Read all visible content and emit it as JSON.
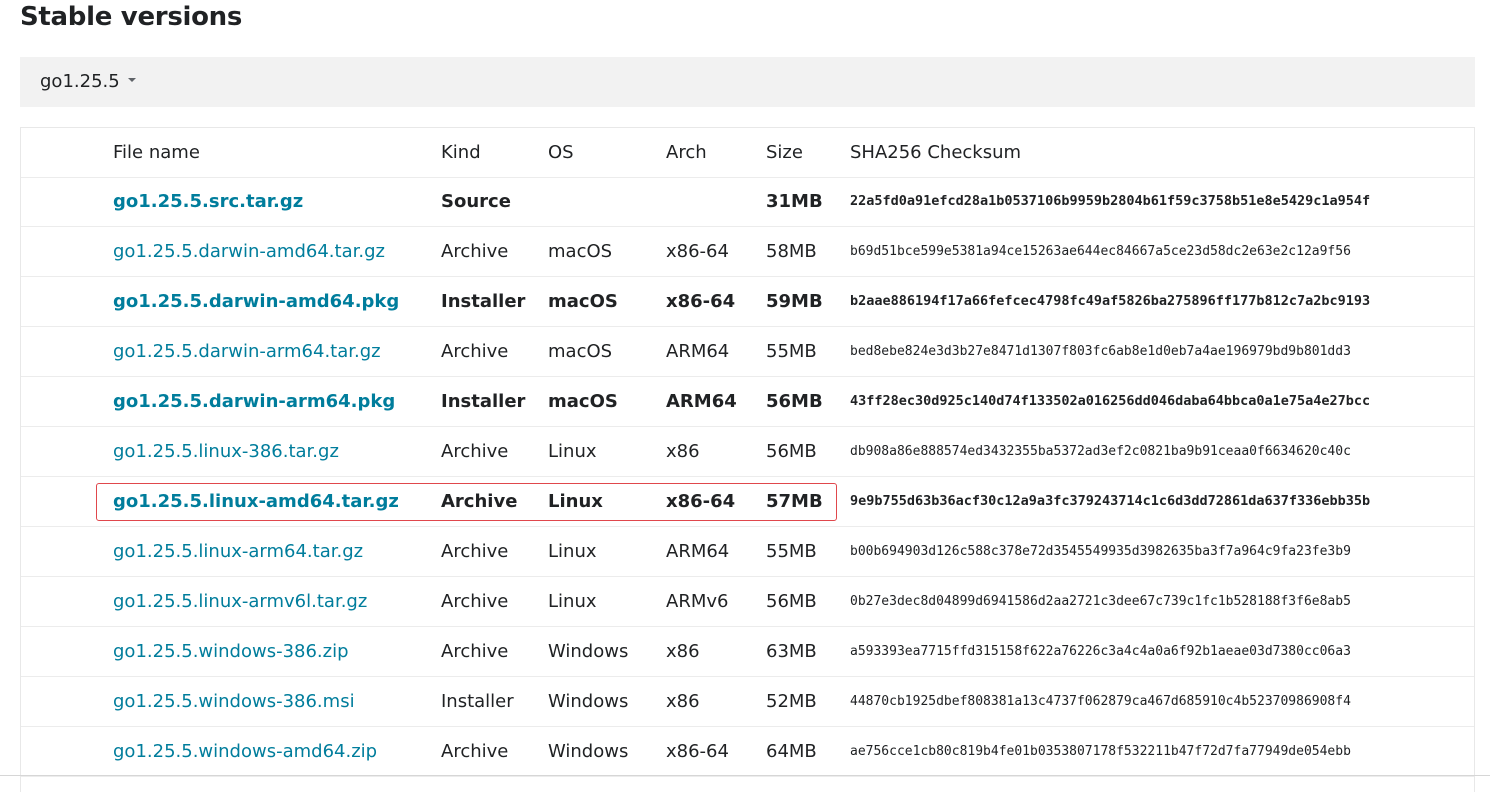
{
  "page": {
    "title": "Stable versions"
  },
  "version_selector": {
    "selected": "go1.25.5"
  },
  "table": {
    "headers": {
      "file": "File name",
      "kind": "Kind",
      "os": "OS",
      "arch": "Arch",
      "size": "Size",
      "checksum": "SHA256 Checksum"
    },
    "rows": [
      {
        "file": "go1.25.5.src.tar.gz",
        "kind": "Source",
        "os": "",
        "arch": "",
        "size": "31MB",
        "checksum": "22a5fd0a91efcd28a1b0537106b9959b2804b61f59c3758b51e8e5429c1a954f",
        "featured": true
      },
      {
        "file": "go1.25.5.darwin-amd64.tar.gz",
        "kind": "Archive",
        "os": "macOS",
        "arch": "x86-64",
        "size": "58MB",
        "checksum": "b69d51bce599e5381a94ce15263ae644ec84667a5ce23d58dc2e63e2c12a9f56",
        "featured": false
      },
      {
        "file": "go1.25.5.darwin-amd64.pkg",
        "kind": "Installer",
        "os": "macOS",
        "arch": "x86-64",
        "size": "59MB",
        "checksum": "b2aae886194f17a66fefcec4798fc49af5826ba275896ff177b812c7a2bc9193",
        "featured": true
      },
      {
        "file": "go1.25.5.darwin-arm64.tar.gz",
        "kind": "Archive",
        "os": "macOS",
        "arch": "ARM64",
        "size": "55MB",
        "checksum": "bed8ebe824e3d3b27e8471d1307f803fc6ab8e1d0eb7a4ae196979bd9b801dd3",
        "featured": false
      },
      {
        "file": "go1.25.5.darwin-arm64.pkg",
        "kind": "Installer",
        "os": "macOS",
        "arch": "ARM64",
        "size": "56MB",
        "checksum": "43ff28ec30d925c140d74f133502a016256dd046daba64bbca0a1e75a4e27bcc",
        "featured": true
      },
      {
        "file": "go1.25.5.linux-386.tar.gz",
        "kind": "Archive",
        "os": "Linux",
        "arch": "x86",
        "size": "56MB",
        "checksum": "db908a86e888574ed3432355ba5372ad3ef2c0821ba9b91ceaa0f6634620c40c",
        "featured": false
      },
      {
        "file": "go1.25.5.linux-amd64.tar.gz",
        "kind": "Archive",
        "os": "Linux",
        "arch": "x86-64",
        "size": "57MB",
        "checksum": "9e9b755d63b36acf30c12a9a3fc379243714c1c6d3dd72861da637f336ebb35b",
        "featured": true
      },
      {
        "file": "go1.25.5.linux-arm64.tar.gz",
        "kind": "Archive",
        "os": "Linux",
        "arch": "ARM64",
        "size": "55MB",
        "checksum": "b00b694903d126c588c378e72d3545549935d3982635ba3f7a964c9fa23fe3b9",
        "featured": false
      },
      {
        "file": "go1.25.5.linux-armv6l.tar.gz",
        "kind": "Archive",
        "os": "Linux",
        "arch": "ARMv6",
        "size": "56MB",
        "checksum": "0b27e3dec8d04899d6941586d2aa2721c3dee67c739c1fc1b528188f3f6e8ab5",
        "featured": false
      },
      {
        "file": "go1.25.5.windows-386.zip",
        "kind": "Archive",
        "os": "Windows",
        "arch": "x86",
        "size": "63MB",
        "checksum": "a593393ea7715ffd315158f622a76226c3a4c4a0a6f92b1aeae03d7380cc06a3",
        "featured": false
      },
      {
        "file": "go1.25.5.windows-386.msi",
        "kind": "Installer",
        "os": "Windows",
        "arch": "x86",
        "size": "52MB",
        "checksum": "44870cb1925dbef808381a13c4737f062879ca467d685910c4b52370986908f4",
        "featured": false
      },
      {
        "file": "go1.25.5.windows-amd64.zip",
        "kind": "Archive",
        "os": "Windows",
        "arch": "x86-64",
        "size": "64MB",
        "checksum": "ae756cce1cb80c819b4fe01b0353807178f532211b47f72d7fa77949de054ebb",
        "featured": false
      }
    ]
  },
  "colors": {
    "link": "#007d9c",
    "highlight_border": "#e0474c",
    "version_bar_bg": "#f2f2f2"
  },
  "icons": {
    "dropdown": "caret-down-icon"
  }
}
